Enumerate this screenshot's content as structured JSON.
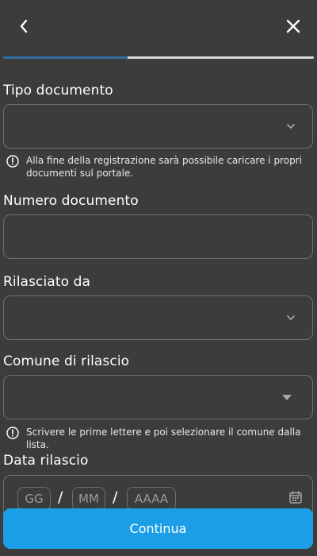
{
  "header": {
    "back_icon": "chevron-left-icon",
    "close_icon": "close-icon"
  },
  "progress": {
    "value": 0.4,
    "fill_color": "#2f6fa3",
    "track_color": "#d9d9d9"
  },
  "form": {
    "tipo_documento": {
      "label": "Tipo documento",
      "value": "",
      "icon": "chevron-down-icon",
      "info": "Alla fine della registrazione sarà possibile caricare i propri documenti sul portale."
    },
    "numero_documento": {
      "label": "Numero documento",
      "value": ""
    },
    "rilasciato_da": {
      "label": "Rilasciato da",
      "value": "",
      "icon": "chevron-down-icon"
    },
    "comune_di_rilascio": {
      "label": "Comune di rilascio",
      "value": "",
      "icon": "caret-down-icon",
      "info": "Scrivere le prime lettere e poi selezionare il comune dalla lista."
    },
    "data_rilascio": {
      "label": "Data rilascio",
      "day_placeholder": "GG",
      "month_placeholder": "MM",
      "year_placeholder": "AAAA",
      "separator": "/",
      "icon": "calendar-icon"
    }
  },
  "actions": {
    "continue_label": "Continua",
    "continue_color": "#1b9ee6"
  },
  "theme": {
    "background": "#3c3c3c",
    "border": "#6e6e6e"
  }
}
